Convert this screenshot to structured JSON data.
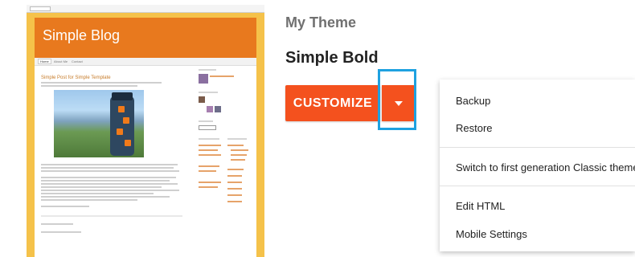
{
  "thumbnail": {
    "blog_title": "Simple Blog",
    "tabs": [
      "Home",
      "About Me",
      "Contact"
    ],
    "post_title": "Simple Post for Simple Template",
    "accent_color": "#e8791e",
    "background_color": "#f5c24a"
  },
  "theme_section": {
    "label": "My Theme",
    "theme_name": "Simple Bold"
  },
  "customize_button": {
    "label": "CUSTOMIZE",
    "color": "#f4511e"
  },
  "dropdown_toggle": {
    "icon": "caret-down-icon",
    "highlight_color": "#1ea1e0"
  },
  "menu": {
    "items": [
      {
        "label": "Backup"
      },
      {
        "label": "Restore"
      },
      {
        "label": "Switch to first generation Classic theme"
      },
      {
        "label": "Edit HTML"
      },
      {
        "label": "Mobile Settings"
      }
    ]
  }
}
